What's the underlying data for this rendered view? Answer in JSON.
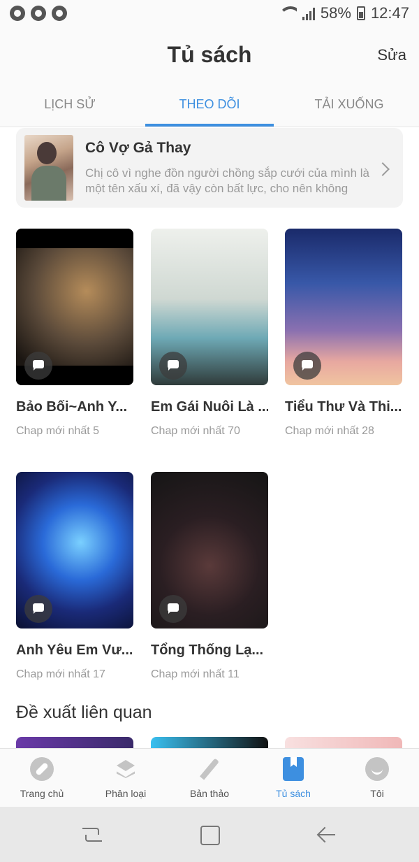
{
  "status_bar": {
    "battery": "58%",
    "time": "12:47",
    "left_icons": [
      "notification-icon",
      "broom-icon",
      "notification-icon"
    ]
  },
  "header": {
    "title": "Tủ sách",
    "edit_label": "Sửa"
  },
  "tabs": [
    {
      "label": "LỊCH SỬ",
      "active": false
    },
    {
      "label": "THEO DÕI",
      "active": true
    },
    {
      "label": "TẢI XUỐNG",
      "active": false
    }
  ],
  "banner": {
    "title": "Cô Vợ Gả Thay",
    "description": "Chị cô vì nghe đồn người chồng sắp cưới của mình là một tên xấu xí, đã vậy còn bất lực, cho nên không"
  },
  "books": [
    {
      "title": "Bảo Bối~Anh Y...",
      "subtitle": "Chap mới nhất 5"
    },
    {
      "title": "Em Gái Nuôi Là ...",
      "subtitle": "Chap mới nhất 70"
    },
    {
      "title": "Tiểu Thư Và Thi...",
      "subtitle": "Chap mới nhất 28"
    },
    {
      "title": "Anh Yêu Em Vư...",
      "subtitle": "Chap mới nhất 17"
    },
    {
      "title": "Tổng Thống Lạ...",
      "subtitle": "Chap mới nhất 11"
    }
  ],
  "related": {
    "title": "Đề xuất liên quan"
  },
  "bottom_nav": [
    {
      "label": "Trang chủ",
      "icon": "compass-icon",
      "active": false
    },
    {
      "label": "Phân loại",
      "icon": "layers-icon",
      "active": false
    },
    {
      "label": "Bản thảo",
      "icon": "pencil-icon",
      "active": false
    },
    {
      "label": "Tủ sách",
      "icon": "bookmark-book-icon",
      "active": true
    },
    {
      "label": "Tôi",
      "icon": "smile-icon",
      "active": false
    }
  ],
  "colors": {
    "accent": "#3d8fe0",
    "muted_text": "#9a9a9a"
  }
}
